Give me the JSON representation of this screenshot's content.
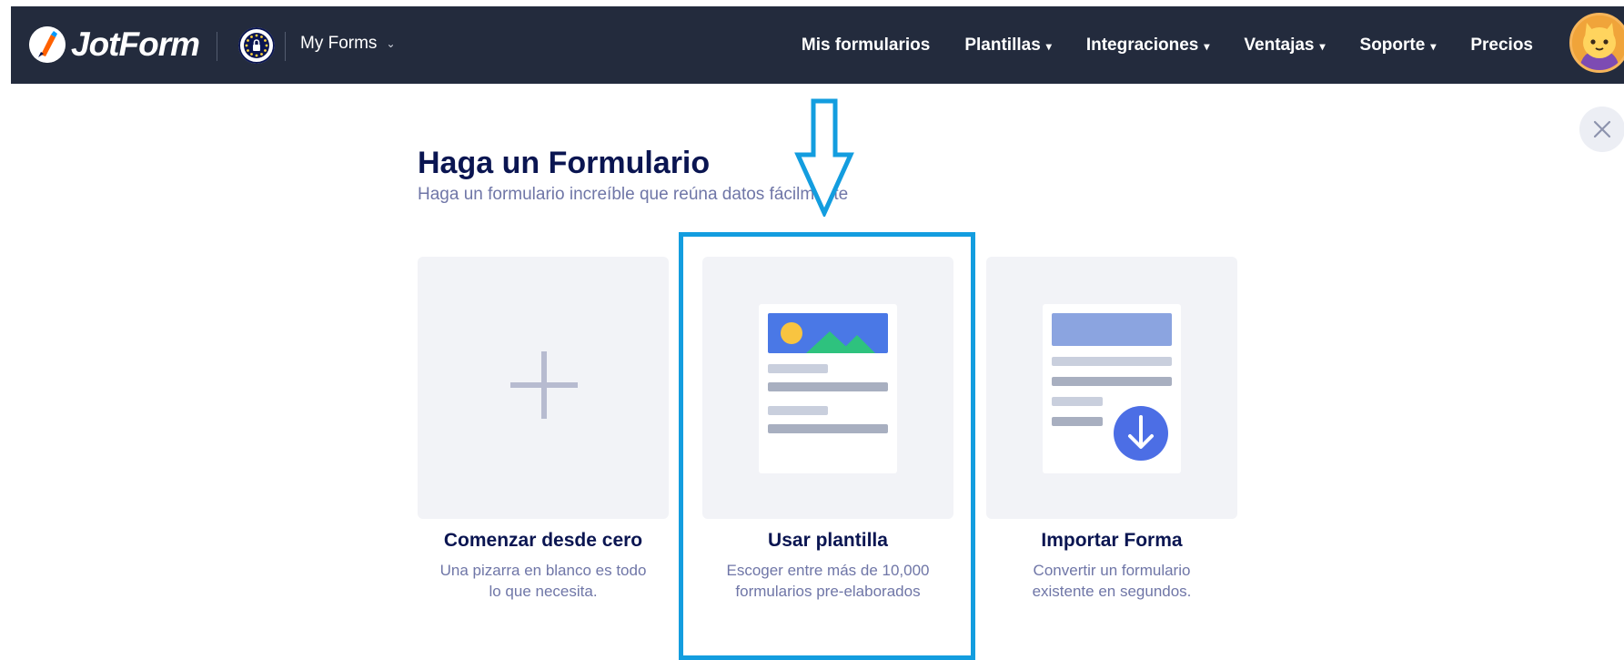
{
  "navbar": {
    "brand": "JotForm",
    "myforms_label": "My Forms",
    "links": [
      {
        "label": "Mis formularios",
        "caret": ""
      },
      {
        "label": "Plantillas",
        "caret": "▾"
      },
      {
        "label": "Integraciones",
        "caret": "▾"
      },
      {
        "label": "Ventajas",
        "caret": "▾"
      },
      {
        "label": "Soporte",
        "caret": "▾"
      },
      {
        "label": "Precios",
        "caret": ""
      }
    ]
  },
  "main": {
    "title": "Haga un Formulario",
    "subtitle": "Haga un formulario increíble que reúna datos fácilmente"
  },
  "cards": [
    {
      "title": "Comenzar desde cero",
      "desc_line1": "Una pizarra en blanco es todo",
      "desc_line2": "lo que necesita."
    },
    {
      "title": "Usar plantilla",
      "desc_line1": "Escoger entre más de 10,000",
      "desc_line2": "formularios pre-elaborados"
    },
    {
      "title": "Importar Forma",
      "desc_line1": "Convertir un formulario",
      "desc_line2": "existente en segundos."
    }
  ],
  "colors": {
    "navbar_bg": "#232b3d",
    "card_bg": "#f2f3f7",
    "title_text": "#0a1551",
    "muted_text": "#6f76a7",
    "annotation": "#139ddf",
    "import_blue": "#4c6ee5"
  },
  "icons": {
    "logo": "jotform-logo-icon",
    "eu": "eu-shield-icon",
    "close": "close-icon",
    "plus": "plus-icon",
    "template": "template-icon",
    "import": "import-icon"
  }
}
